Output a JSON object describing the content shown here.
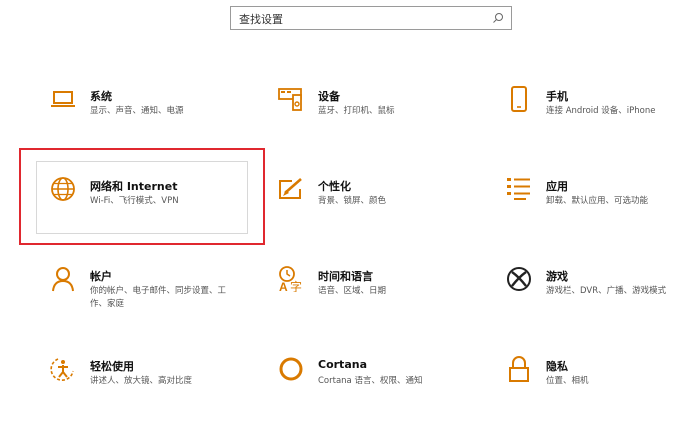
{
  "search": {
    "placeholder": "查找设置"
  },
  "tiles": [
    {
      "icon": "laptop-icon",
      "title": "系统",
      "desc": "显示、声音、通知、电源"
    },
    {
      "icon": "devices-icon",
      "title": "设备",
      "desc": "蓝牙、打印机、鼠标"
    },
    {
      "icon": "phone-icon",
      "title": "手机",
      "desc": "连接 Android 设备、iPhone"
    },
    {
      "icon": "globe-icon",
      "title": "网络和 Internet",
      "desc": "Wi-Fi、飞行模式、VPN"
    },
    {
      "icon": "personalization-icon",
      "title": "个性化",
      "desc": "背景、锁屏、颜色"
    },
    {
      "icon": "apps-list-icon",
      "title": "应用",
      "desc": "卸载、默认应用、可选功能"
    },
    {
      "icon": "person-icon",
      "title": "帐户",
      "desc": "你的帐户、电子邮件、同步设置、工作、家庭"
    },
    {
      "icon": "time-language-icon",
      "title": "时间和语言",
      "desc": "语音、区域、日期"
    },
    {
      "icon": "xbox-icon",
      "title": "游戏",
      "desc": "游戏栏、DVR、广播、游戏模式"
    },
    {
      "icon": "ease-of-access-icon",
      "title": "轻松使用",
      "desc": "讲述人、放大镜、高对比度"
    },
    {
      "icon": "cortana-icon",
      "title": "Cortana",
      "desc": "Cortana 语言、权限、通知"
    },
    {
      "icon": "lock-icon",
      "title": "隐私",
      "desc": "位置、相机"
    }
  ],
  "colors": {
    "accent": "#d97a00",
    "highlight": "#e0282f"
  }
}
